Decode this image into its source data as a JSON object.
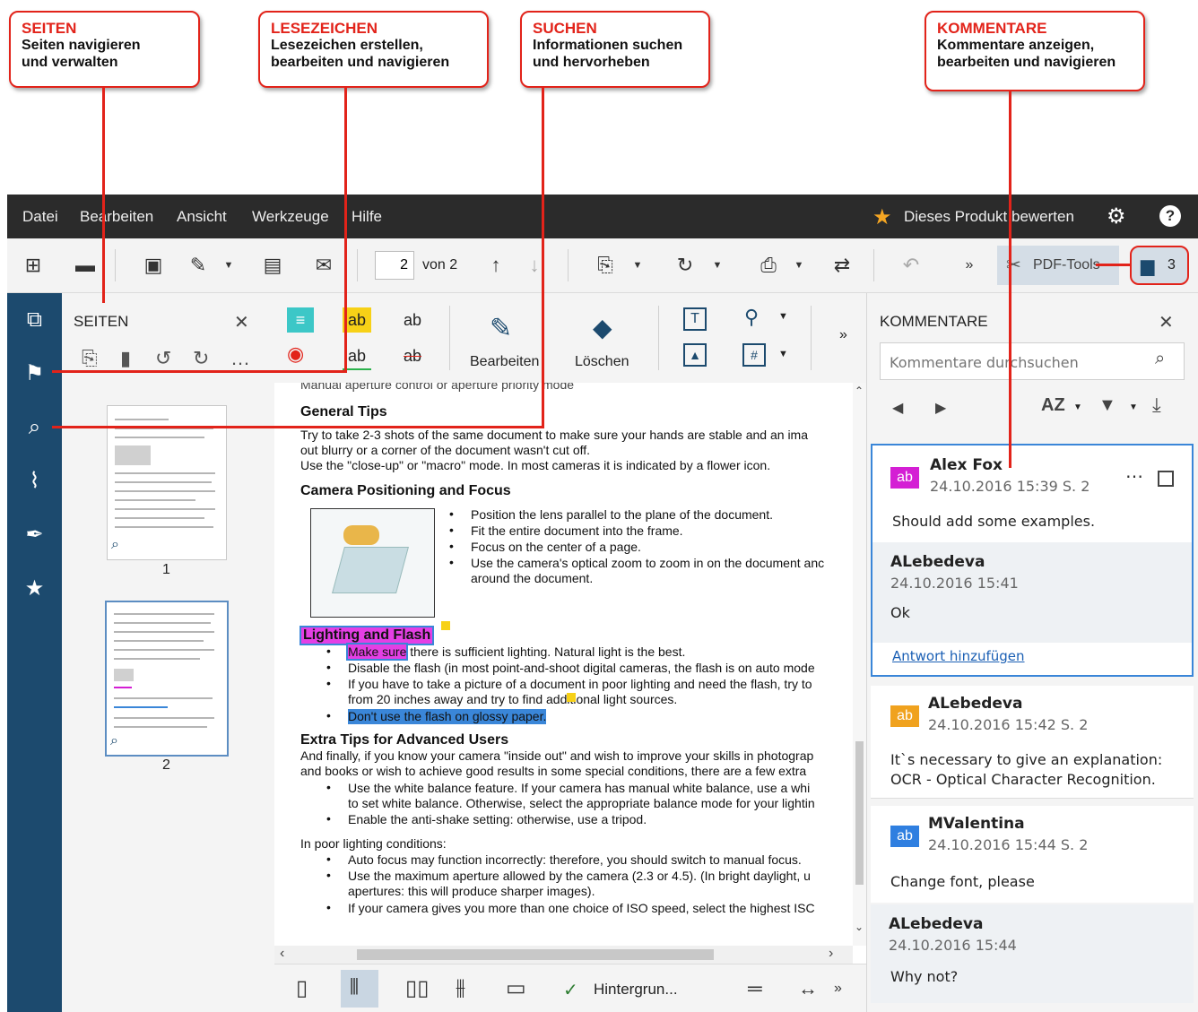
{
  "callouts": {
    "seiten": {
      "title": "SEITEN",
      "desc1": "Seiten navigieren",
      "desc2": "und verwalten"
    },
    "lesezeichen": {
      "title": "LESEZEICHEN",
      "desc1": "Lesezeichen erstellen,",
      "desc2": "bearbeiten und navigieren"
    },
    "suchen": {
      "title": "SUCHEN",
      "desc1": "Informationen suchen",
      "desc2": "und hervorheben"
    },
    "kommentare": {
      "title": "KOMMENTARE",
      "desc1": "Kommentare anzeigen,",
      "desc2": "bearbeiten und navigieren"
    }
  },
  "menu": {
    "items": [
      "Datei",
      "Bearbeiten",
      "Ansicht",
      "Werkzeuge",
      "Hilfe"
    ],
    "rate": "Dieses Produkt bewerten"
  },
  "toolbar": {
    "page_value": "2",
    "page_of": "von 2",
    "pdf_tools": "PDF-Tools",
    "comment_count": "3"
  },
  "pages_panel": {
    "title": "SEITEN",
    "thumb1": "1",
    "thumb2": "2"
  },
  "doc_tools": {
    "bearbeiten": "Bearbeiten",
    "loeschen": "Löschen",
    "ab": "ab"
  },
  "doc": {
    "top_cut": "Manual aperture control or aperture priority mode",
    "general_tips": "General Tips",
    "gt1": "Try to take 2-3 shots of the same document to make sure your hands are stable and an ima",
    "gt2": "out blurry or a corner of the document wasn't cut off.",
    "gt3": "Use the \"close-up\" or \"macro\" mode. In most cameras it is indicated by a flower icon.",
    "camera": "Camera Positioning and Focus",
    "c1": "Position the lens parallel to the plane of the document.",
    "c2": "Fit the entire document into the frame.",
    "c3": "Focus on the center of a page.",
    "c4a": "Use the camera's optical zoom to zoom in on the document anc",
    "c4b": "around the document.",
    "lighting": "Lighting and Flash",
    "l1a": "Make sure",
    "l1b": " there is sufficient lighting. Natural light is the best.",
    "l2": "Disable the flash (in most point-and-shoot digital cameras, the flash is on auto mode",
    "l3a": "If you have to take a picture of a document in poor lighting and need the flash, try to",
    "l3b": "from 20 inches away and try to find additional light sources.",
    "l4": "Don't use the flash on glossy paper.",
    "extra": "Extra Tips for Advanced Users",
    "e1": "And finally, if you know your camera \"inside out\" and wish to improve your skills in photograp",
    "e2": "and books or wish to achieve good results in some special conditions, there are a few extra",
    "e3a": "Use the white balance feature. If your camera has manual white balance, use a whi",
    "e3b": "to set white balance. Otherwise, select the appropriate balance mode for your lightin",
    "e4": "Enable the anti-shake setting: otherwise, use a tripod.",
    "poor": "In poor lighting conditions:",
    "p1": "Auto focus may function incorrectly: therefore, you should switch to manual focus.",
    "p2a": "Use the maximum aperture allowed by the camera (2.3 or 4.5). (In bright daylight, u",
    "p2b": "apertures: this will produce sharper images).",
    "p3": "If your camera gives you more than one choice of ISO speed, select the highest ISC"
  },
  "bottombar": {
    "background": "Hintergrun..."
  },
  "comments_panel": {
    "title": "KOMMENTARE",
    "search_placeholder": "Kommentare durchsuchen",
    "sort": "AZ",
    "items": [
      {
        "author": "Alex Fox",
        "date": "24.10.2016 15:39  S. 2",
        "text": "Should add some examples.",
        "color": "#d41fd4"
      },
      {
        "author": "ALebedeva",
        "date": "24.10.2016 15:41",
        "text": "Ok"
      },
      {
        "reply": "Antwort hinzufügen"
      },
      {
        "author": "ALebedeva",
        "date": "24.10.2016 15:42  S. 2",
        "text1": "It`s necessary to give an explanation:",
        "text2": "OCR - Optical Character Recognition.",
        "color": "#f0a21e"
      },
      {
        "author": "MValentina",
        "date": "24.10.2016 15:44  S. 2",
        "text": "Change font, please",
        "color": "#2f7fe0"
      },
      {
        "author": "ALebedeva",
        "date": "24.10.2016 15:44",
        "text": "Why not?"
      }
    ]
  },
  "colors": {
    "accent": "#e2231a",
    "rail": "#1c4a6e",
    "menubar": "#2b2b2b",
    "selection": "#3a86d8"
  }
}
